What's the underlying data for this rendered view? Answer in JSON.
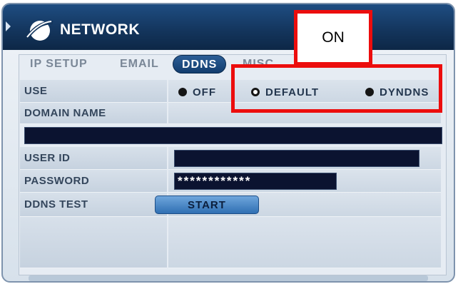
{
  "window": {
    "title": "NETWORK",
    "icon": "network-globe-icon"
  },
  "tabs": [
    {
      "label": "IP SETUP",
      "active": false
    },
    {
      "label": "EMAIL",
      "active": false
    },
    {
      "label": "DDNS",
      "active": true
    },
    {
      "label": "MISC.",
      "active": false
    }
  ],
  "settings": {
    "use": {
      "label": "USE",
      "options": [
        {
          "label": "OFF",
          "state": "filled"
        },
        {
          "label": "DEFAULT",
          "state": "selected"
        },
        {
          "label": "DYNDNS",
          "state": "filled"
        }
      ]
    },
    "domain_name": {
      "label": "DOMAIN NAME",
      "value": ""
    },
    "user_id": {
      "label": "USER ID",
      "value": ""
    },
    "password": {
      "label": "PASSWORD",
      "value": "************"
    },
    "ddns_test": {
      "label": "DDNS TEST",
      "button": "START"
    }
  },
  "annotation": {
    "label": "ON",
    "color": "#ec0d0d"
  },
  "colors": {
    "title_bar": "#14365e",
    "field_bg": "#0b1330",
    "button": "#4a8ac9"
  }
}
